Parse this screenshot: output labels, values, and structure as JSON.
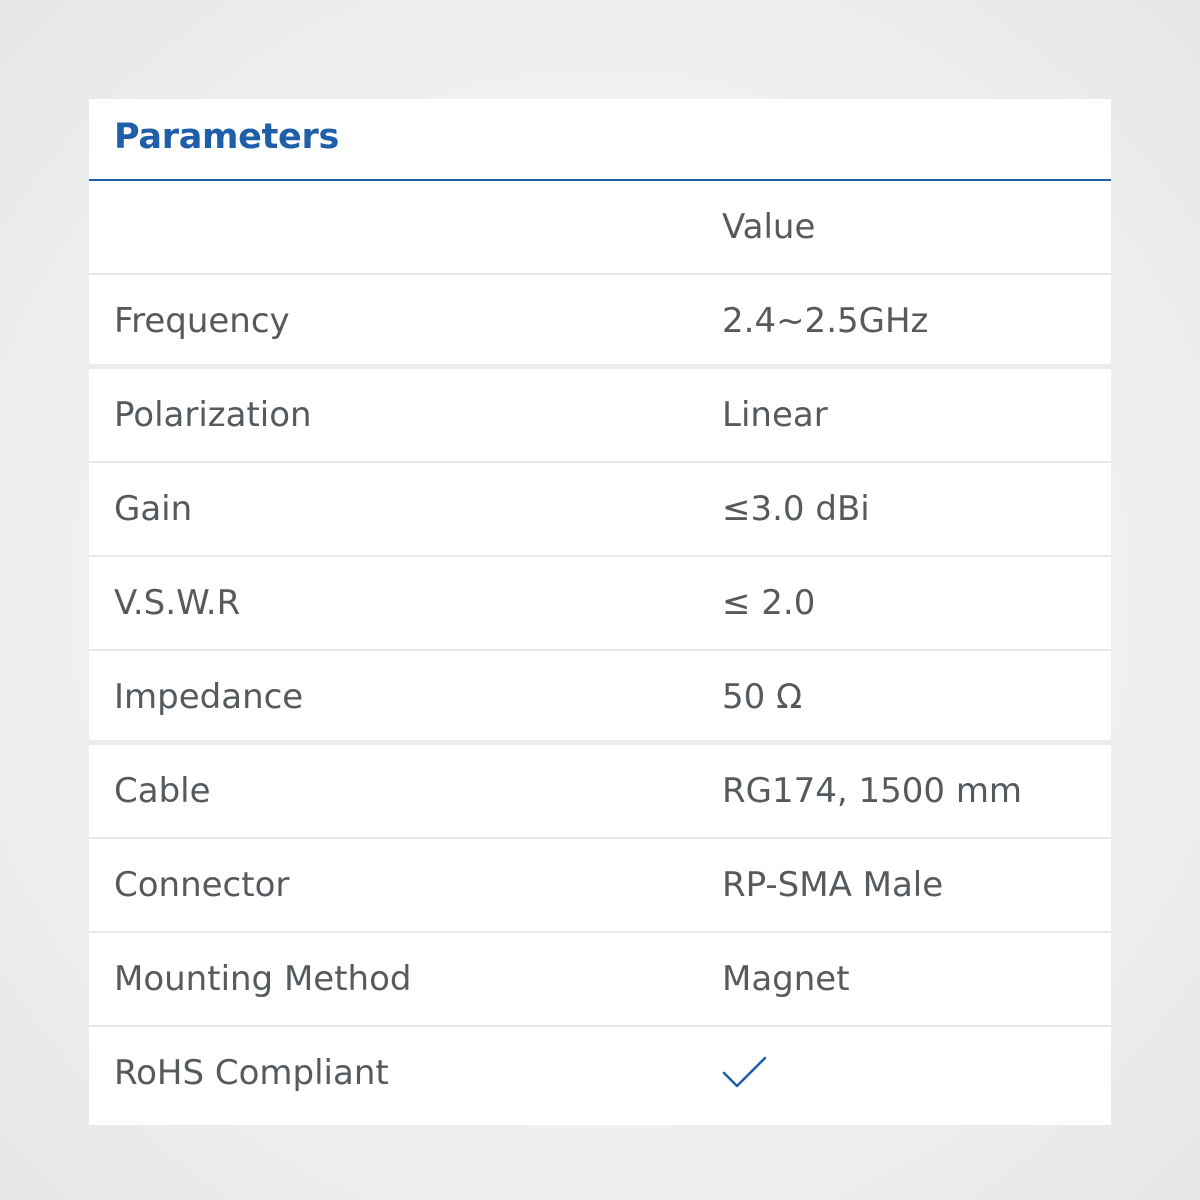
{
  "table": {
    "title": "Parameters",
    "header": {
      "param": "",
      "value": "Value"
    },
    "rows": [
      {
        "param": "Frequency",
        "value": "2.4~2.5GHz"
      },
      {
        "param": "Polarization",
        "value": "Linear"
      },
      {
        "param": "Gain",
        "value": "≤3.0 dBi"
      },
      {
        "param": "V.S.W.R",
        "value": "≤ 2.0"
      },
      {
        "param": "Impedance",
        "value": "50 Ω"
      },
      {
        "param": "Cable",
        "value": "RG174, 1500 mm"
      },
      {
        "param": "Connector",
        "value": "RP-SMA Male"
      },
      {
        "param": "Mounting Method",
        "value": "Magnet"
      },
      {
        "param": "RoHS Compliant",
        "value_icon": "checkmark-icon"
      }
    ]
  },
  "colors": {
    "accent": "#1f5ea8",
    "text": "#555a5e",
    "divider": "#e6e8ea",
    "background": "#ffffff"
  }
}
